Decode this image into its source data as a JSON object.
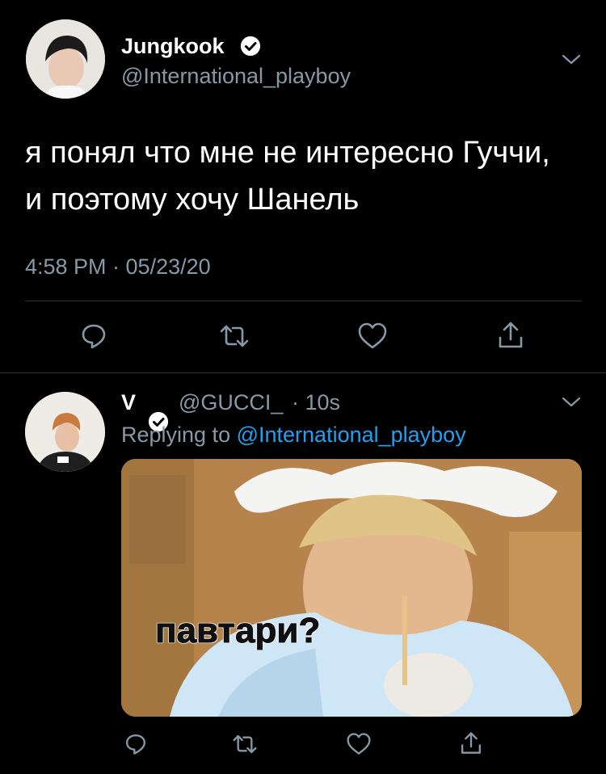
{
  "tweet1": {
    "display_name": "Jungkook",
    "handle": "@International_playboy",
    "text_line1": "я понял что мне не интересно Гуччи,",
    "text_line2": "и поэтому хочу Шанель",
    "timestamp": "4:58 PM · 05/23/20"
  },
  "tweet2": {
    "display_name": "V",
    "handle": "@GUCCI_",
    "time": "· 10s",
    "replying_prefix": "Replying to",
    "replying_handle": "@International_playboy",
    "image_caption": "павтари?"
  },
  "icons": [
    "verified-badge-icon",
    "chevron-down-icon",
    "reply-icon",
    "retweet-icon",
    "like-icon",
    "share-icon"
  ],
  "colors": {
    "background": "#000000",
    "muted": "#8899a6",
    "accent": "#1da1f2",
    "divider": "#2f3336"
  }
}
